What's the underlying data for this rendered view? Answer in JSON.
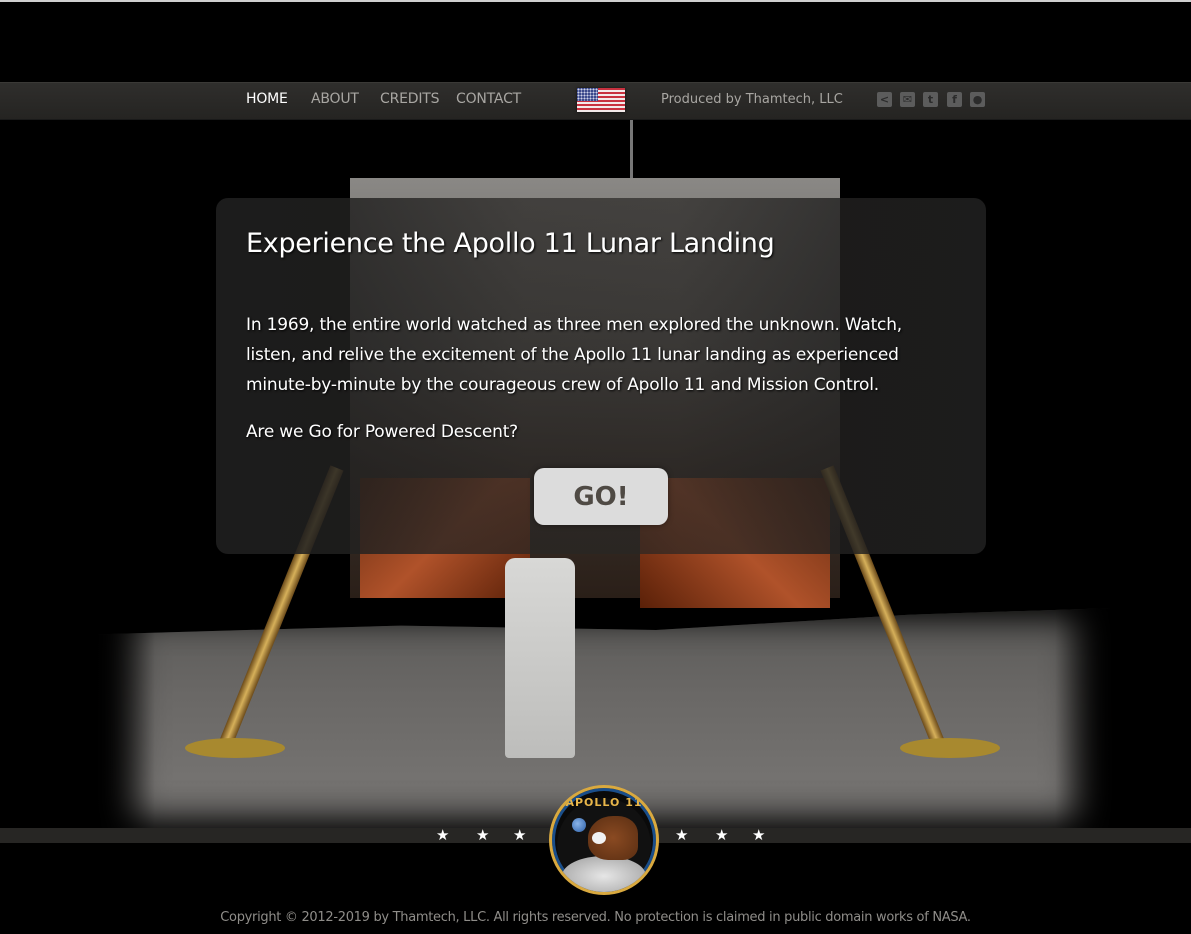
{
  "nav": {
    "links": [
      {
        "label": "HOME",
        "active": true
      },
      {
        "label": "ABOUT",
        "active": false
      },
      {
        "label": "CREDITS",
        "active": false
      },
      {
        "label": "CONTACT",
        "active": false
      }
    ],
    "language_flag": "us-flag-icon",
    "produced_by": "Produced by Thamtech, LLC",
    "social_icons": [
      "share-icon",
      "email-icon",
      "twitter-icon",
      "facebook-icon",
      "reddit-icon"
    ]
  },
  "intro": {
    "title": "Experience the Apollo 11 Lunar Landing",
    "body": "In 1969, the entire world watched as three men explored the unknown. Watch, listen, and relive the excitement of the Apollo 11 lunar landing as experienced minute-by-minute by the courageous crew of Apollo 11 and Mission Control.",
    "question": "Are we Go for Powered Descent?",
    "go_label": "GO!"
  },
  "footer": {
    "patch_label": "APOLLO 11",
    "copyright": "Copyright © 2012-2019 by Thamtech, LLC. All rights reserved. No protection is claimed in public domain works of NASA."
  },
  "colors": {
    "background": "#000000",
    "navbar": "#2b2a28",
    "nav_text": "#a8a6a2",
    "nav_active": "#ffffff",
    "go_button_bg": "#dcdcdc",
    "go_button_text": "#4f4a44",
    "patch_gold": "#d9a93f"
  }
}
